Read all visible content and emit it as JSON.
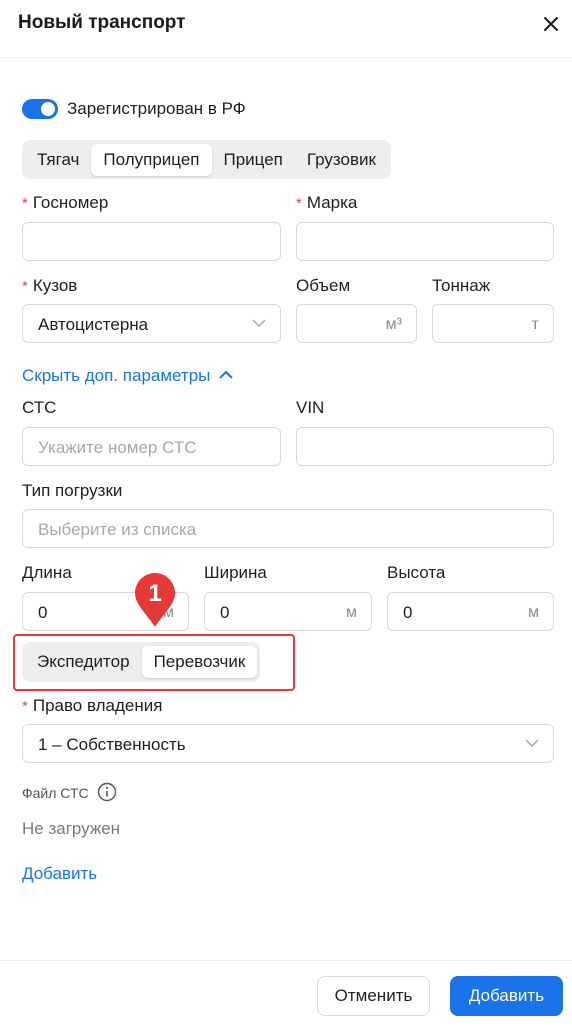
{
  "header": {
    "title": "Новый транспорт"
  },
  "toggle": {
    "label": "Зарегистрирован в РФ",
    "on": true
  },
  "type_tabs": {
    "items": [
      "Тягач",
      "Полуприцеп",
      "Прицеп",
      "Грузовик"
    ],
    "active": "Полуприцеп"
  },
  "fields": {
    "gosnomer": {
      "label": "Госномер",
      "value": ""
    },
    "marka": {
      "label": "Марка",
      "value": ""
    },
    "kuzov": {
      "label": "Кузов",
      "value": "Автоцистерна"
    },
    "obem": {
      "label": "Объем",
      "unit": "м³"
    },
    "tonnazh": {
      "label": "Тоннаж",
      "unit": "т"
    },
    "sts": {
      "label": "СТС",
      "placeholder": "Укажите номер СТС"
    },
    "vin": {
      "label": "VIN",
      "value": ""
    },
    "tip_pogruzki": {
      "label": "Тип погрузки",
      "placeholder": "Выберите из списка"
    },
    "dlina": {
      "label": "Длина",
      "value": "0",
      "unit": "м"
    },
    "shirina": {
      "label": "Ширина",
      "value": "0",
      "unit": "м"
    },
    "vysota": {
      "label": "Высота",
      "value": "0",
      "unit": "м"
    },
    "pravo": {
      "label": "Право владения",
      "value": "1 – Собственность"
    }
  },
  "toggle_params_link": "Скрыть доп. параметры",
  "role_tabs": {
    "items": [
      "Экспедитор",
      "Перевозчик"
    ],
    "active": "Перевозчик"
  },
  "file": {
    "label": "Файл СТС",
    "status": "Не загружен",
    "add_link": "Добавить"
  },
  "annotation": {
    "marker": "1"
  },
  "footer": {
    "cancel": "Отменить",
    "submit": "Добавить"
  },
  "colors": {
    "accent": "#1a73e8",
    "required": "#e5484d",
    "highlight": "#e53935"
  }
}
